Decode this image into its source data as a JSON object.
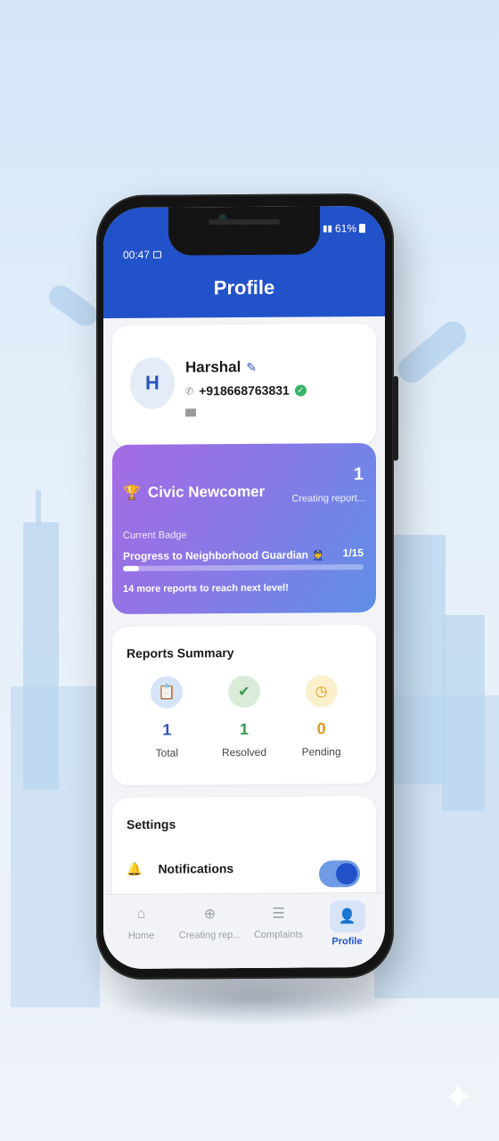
{
  "status_bar": {
    "time": "00:47",
    "battery": "61%"
  },
  "header": {
    "title": "Profile"
  },
  "profile": {
    "avatar_initial": "H",
    "name": "Harshal",
    "phone": "+918668763831"
  },
  "badge": {
    "title": "Civic Newcomer",
    "count": "1",
    "subtitle": "Creating report...",
    "current_label": "Current Badge",
    "progress_label": "Progress to Neighborhood Guardian",
    "progress_count": "1/15",
    "progress_fraction": 0.067,
    "next_level_note": "14 more reports to reach next level!"
  },
  "summary": {
    "title": "Reports Summary",
    "stats": [
      {
        "value": "1",
        "label": "Total",
        "icon": "clipboard-icon",
        "color": "#2a55b8",
        "bg": "#d6e4f8"
      },
      {
        "value": "1",
        "label": "Resolved",
        "icon": "check-circle-icon",
        "color": "#3b9a52",
        "bg": "#d8ecd9"
      },
      {
        "value": "0",
        "label": "Pending",
        "icon": "clock-icon",
        "color": "#d99a1e",
        "bg": "#fbf0cc"
      }
    ]
  },
  "settings": {
    "title": "Settings",
    "notifications_label": "Notifications",
    "notifications_on": true
  },
  "nav": {
    "items": [
      {
        "label": "Home",
        "icon": "home-icon"
      },
      {
        "label": "Creating rep...",
        "icon": "plus-circle-icon"
      },
      {
        "label": "Complaints",
        "icon": "list-icon"
      },
      {
        "label": "Profile",
        "icon": "person-icon"
      }
    ],
    "active": "Profile"
  },
  "colors": {
    "primary": "#2252c9",
    "background": "#f3f4f7"
  }
}
